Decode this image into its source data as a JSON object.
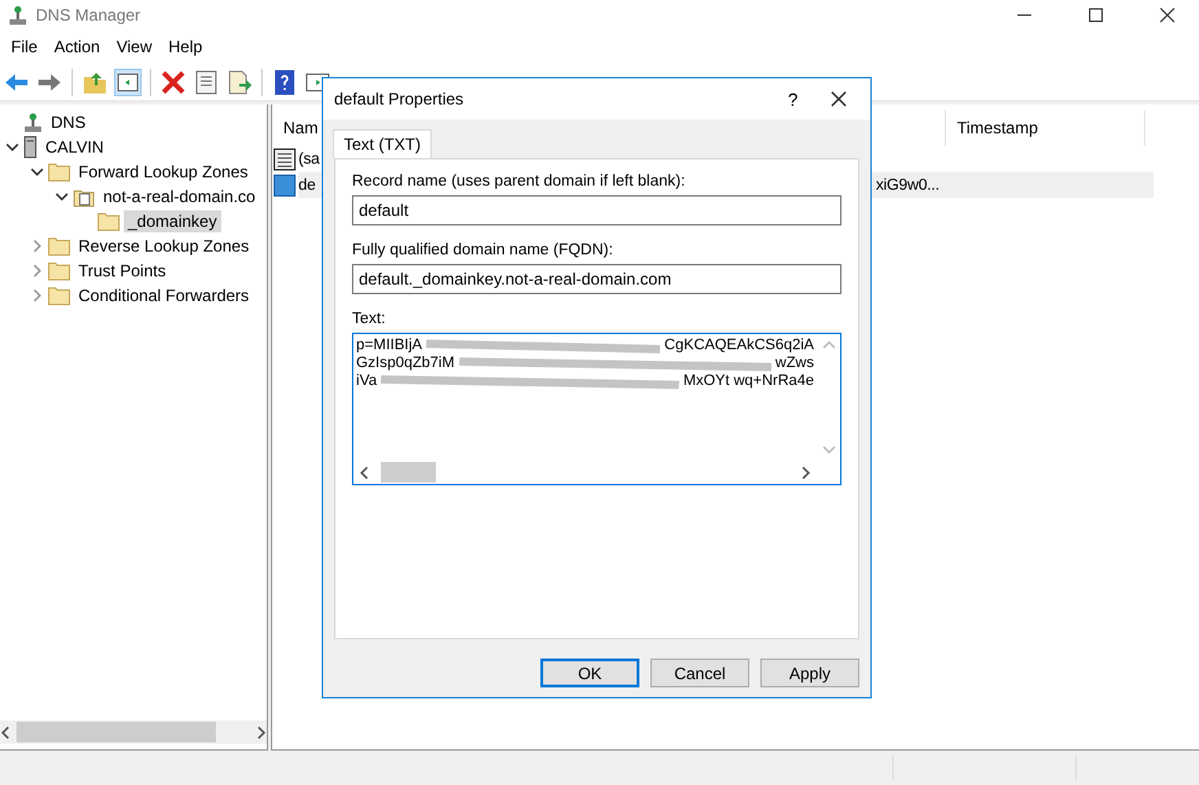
{
  "window": {
    "title": "DNS Manager"
  },
  "menu": [
    "File",
    "Action",
    "View",
    "Help"
  ],
  "tree": [
    {
      "label": "DNS",
      "kind": "root",
      "selected": false
    },
    {
      "label": "CALVIN",
      "kind": "server",
      "expanded": true,
      "selected": false,
      "children": [
        {
          "label": "Forward Lookup Zones",
          "kind": "folder",
          "expanded": true,
          "selected": false,
          "children": [
            {
              "label": "not-a-real-domain.co",
              "kind": "zone",
              "expanded": true,
              "selected": false,
              "children": [
                {
                  "label": "_domainkey",
                  "kind": "folder",
                  "selected": true
                }
              ]
            }
          ]
        },
        {
          "label": "Reverse Lookup Zones",
          "kind": "folder",
          "expanded": false,
          "selected": false
        },
        {
          "label": "Trust Points",
          "kind": "folder",
          "expanded": false,
          "selected": false
        },
        {
          "label": "Conditional Forwarders",
          "kind": "folder",
          "expanded": false,
          "selected": false
        }
      ]
    }
  ],
  "list": {
    "columns": [
      "Nam",
      "Timestamp"
    ],
    "rows": [
      {
        "name": "(sa",
        "selected": false
      },
      {
        "name": "de",
        "data": "xiG9w0...",
        "selected": true
      }
    ]
  },
  "dialog": {
    "title": "default Properties",
    "help": "?",
    "tab": "Text (TXT)",
    "fields": [
      {
        "label": "Record name (uses parent domain if left blank):",
        "value": "default"
      },
      {
        "label": "Fully qualified domain name (FQDN):",
        "value": "default._domainkey.not-a-real-domain.com"
      }
    ],
    "text_label": "Text:",
    "text_lines": [
      {
        "left": "p=MIIBIjA",
        "right": "CgKCAQEAkCS6q2iA"
      },
      {
        "left": "GzIsp0qZb7iM",
        "right": "wZws"
      },
      {
        "left": "iVa",
        "right": "MxOYt  wq+NrRa4e"
      }
    ],
    "buttons": [
      {
        "label": "OK",
        "default": true
      },
      {
        "label": "Cancel",
        "default": false
      },
      {
        "label": "Apply",
        "default": false
      }
    ]
  }
}
